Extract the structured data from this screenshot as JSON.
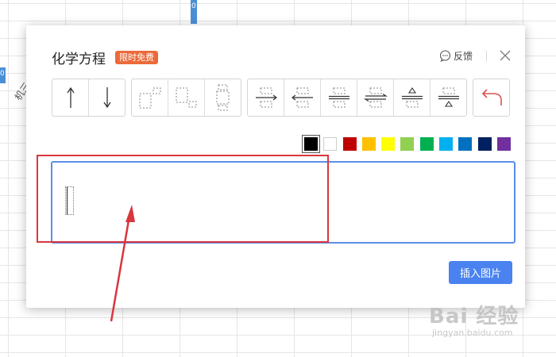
{
  "background": {
    "bar_label": "0",
    "left_bar_label": "0",
    "rotated_text": "机三"
  },
  "dialog": {
    "title": "化学方程",
    "badge": "限时免费",
    "feedback_label": "反馈",
    "insert_button_label": "插入图片"
  },
  "toolbar": {
    "groups": [
      [
        "arrow-up",
        "arrow-down"
      ],
      [
        "superscript-template",
        "subscript-template",
        "over-under-template"
      ],
      [
        "right-arrow-over-under",
        "left-arrow-over-under",
        "equals-over-under",
        "equilibrium-over-under",
        "delta-over",
        "delta-under"
      ],
      [
        "undo"
      ]
    ]
  },
  "colors": {
    "swatches": [
      "#000000",
      "#ffffff",
      "#c00000",
      "#ffc000",
      "#ffff00",
      "#92d050",
      "#00b050",
      "#00b0f0",
      "#0070c0",
      "#002060",
      "#7030a0"
    ],
    "selected": "#000000",
    "accent": "#4a82f0",
    "badge": "#ec6a3a",
    "annotation": "#d9363e"
  },
  "watermark": {
    "main": "Bai 经验",
    "sub": "jingyan.baidu.com"
  }
}
